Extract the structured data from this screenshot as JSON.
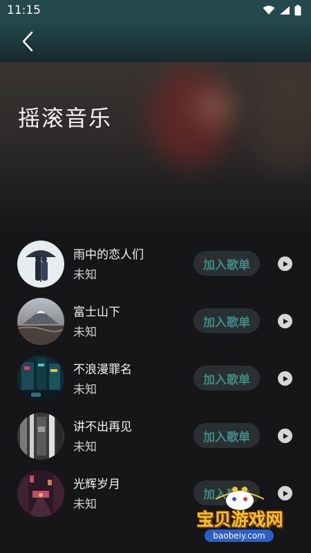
{
  "status_bar": {
    "time": "11:15"
  },
  "page": {
    "title": "摇滚音乐"
  },
  "songs": [
    {
      "title": "雨中的恋人们",
      "artist": "未知",
      "add_label": "加入歌单"
    },
    {
      "title": "富士山下",
      "artist": "未知",
      "add_label": "加入歌单"
    },
    {
      "title": "不浪漫罪名",
      "artist": "未知",
      "add_label": "加入歌单"
    },
    {
      "title": "讲不出再见",
      "artist": "未知",
      "add_label": "加入歌单"
    },
    {
      "title": "光辉岁月",
      "artist": "未知",
      "add_label": "加入歌单"
    }
  ],
  "watermark": {
    "text": "宝贝游戏网",
    "url": "baobeiy.com"
  },
  "colors": {
    "accent": "#3e8a86",
    "app_bar": "#23494d",
    "background": "#161618"
  }
}
